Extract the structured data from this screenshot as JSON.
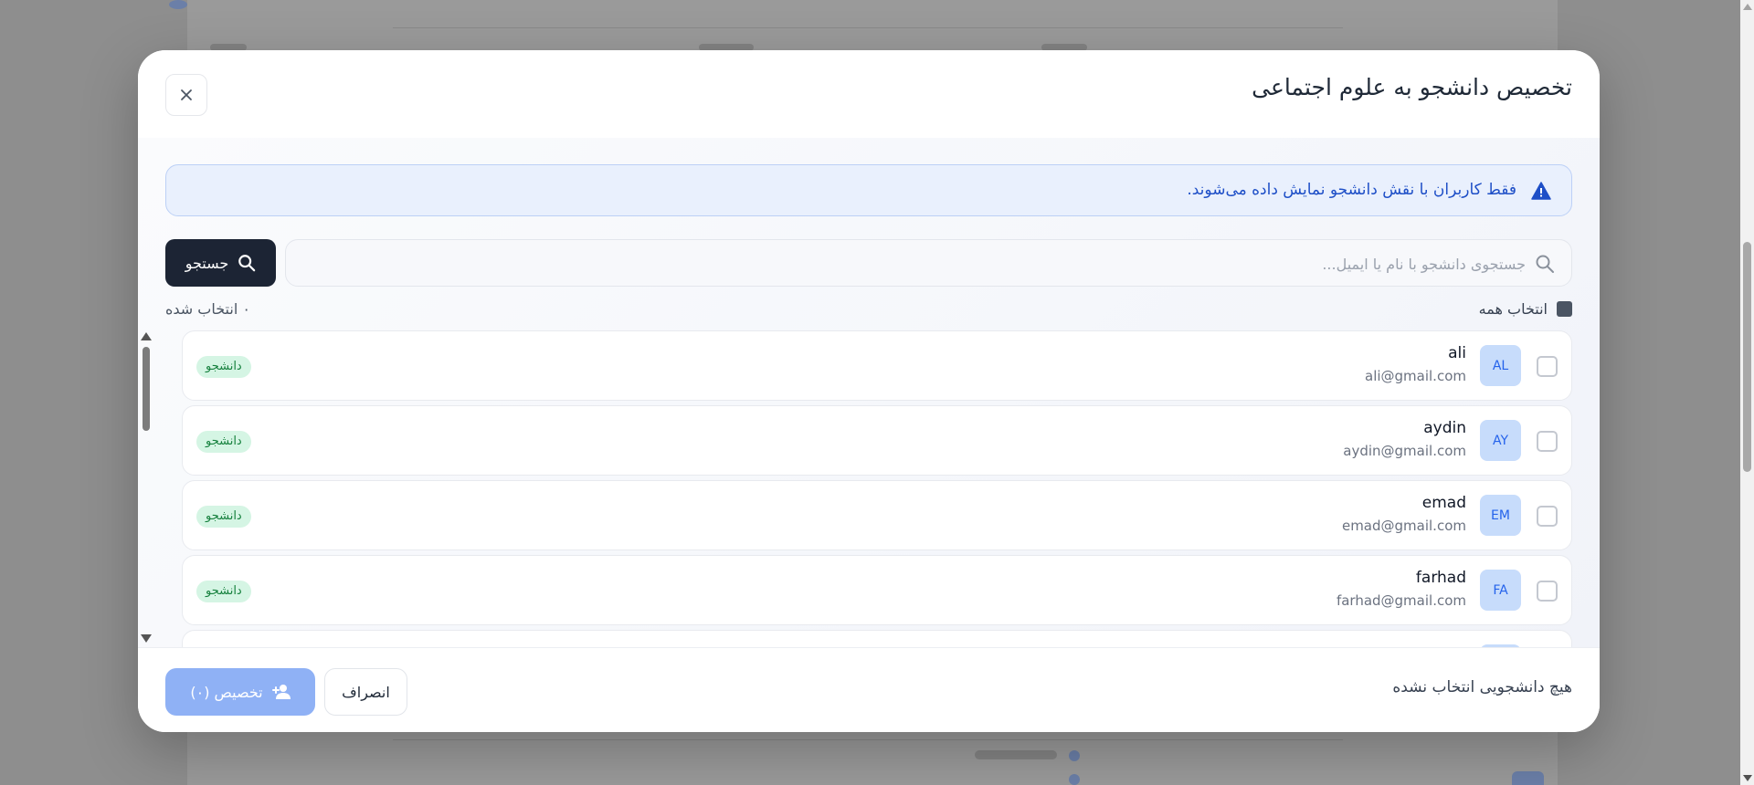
{
  "modal": {
    "title": "تخصیص دانشجو به علوم اجتماعی",
    "notice": "فقط کاربران با نقش دانشجو نمایش داده می‌شوند.",
    "search": {
      "placeholder": "جستجوی دانشجو با نام یا ایمیل...",
      "value": "",
      "button_label": "جستجو"
    },
    "select_all_label": "انتخاب همه",
    "selected_count": "۰ انتخاب شده",
    "students": [
      {
        "initials": "AL",
        "name": "ali",
        "email": "ali@gmail.com",
        "role": "دانشجو"
      },
      {
        "initials": "AY",
        "name": "aydin",
        "email": "aydin@gmail.com",
        "role": "دانشجو"
      },
      {
        "initials": "EM",
        "name": "emad",
        "email": "emad@gmail.com",
        "role": "دانشجو"
      },
      {
        "initials": "FA",
        "name": "farhad",
        "email": "farhad@gmail.com",
        "role": "دانشجو"
      }
    ],
    "footer": {
      "status": "هیچ دانشجویی انتخاب نشده",
      "cancel_label": "انصراف",
      "assign_label": "تخصیص (۰)"
    }
  },
  "colors": {
    "primary_dark": "#1c2434",
    "assign_disabled": "#8fb1f5",
    "notice_bg": "#e9f0fd",
    "notice_text": "#1e4fc7",
    "badge_bg": "#d5f5e4",
    "badge_text": "#15803d",
    "avatar_bg": "#c7dcfb"
  },
  "icons": {
    "close": "close-icon",
    "warning": "warning-icon",
    "search": "search-icon",
    "add_user": "user-plus-icon"
  }
}
